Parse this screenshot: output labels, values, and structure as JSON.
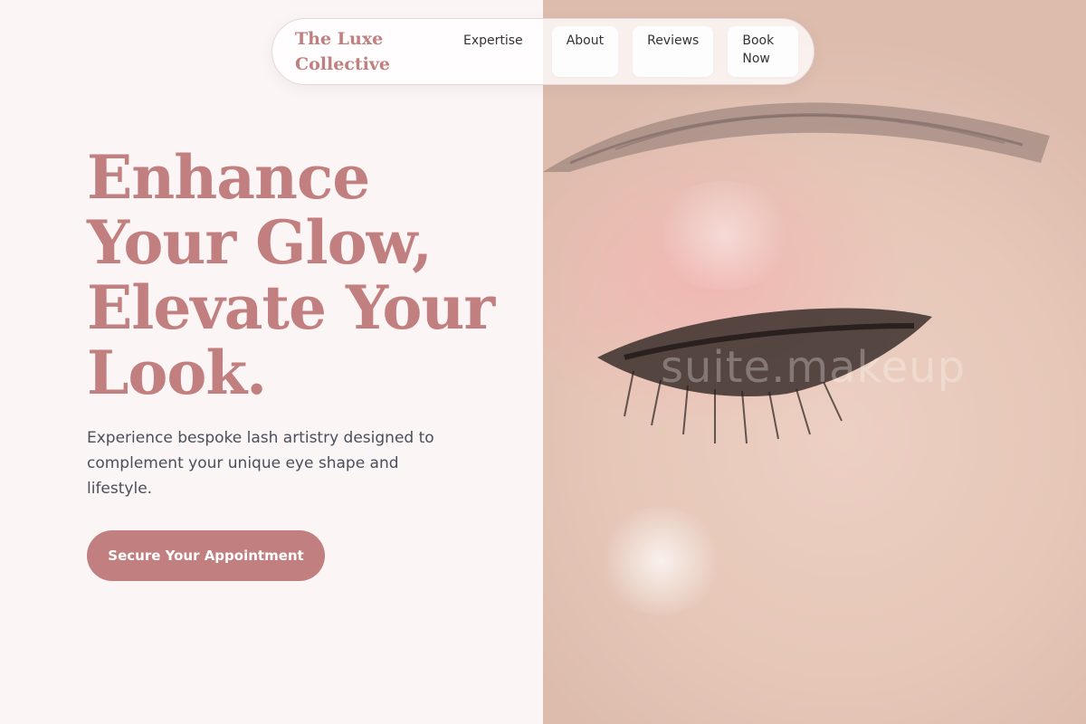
{
  "nav": {
    "brand": "The Luxe Collective",
    "links": [
      {
        "label": "Expertise"
      },
      {
        "label": "About"
      },
      {
        "label": "Reviews"
      },
      {
        "label": "Book Now"
      }
    ]
  },
  "hero": {
    "title": "Enhance Your Glow, Elevate Your Look.",
    "subtitle": "Experience bespoke lash artistry designed to complement your unique eye shape and lifestyle.",
    "cta_label": "Secure Your Appointment"
  },
  "image": {
    "watermark": "suite.makeup"
  },
  "colors": {
    "accent": "#c17f7f",
    "background": "#fcf5f5",
    "body_text": "#4a4f5c"
  }
}
